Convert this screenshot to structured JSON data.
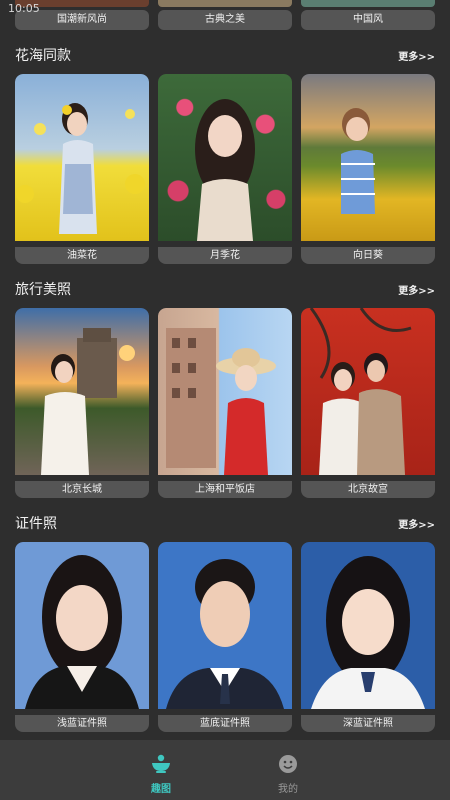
{
  "status_bar": {
    "time": "10:05"
  },
  "top_row": [
    {
      "label": "国潮新风尚",
      "color": "#6a3f2e"
    },
    {
      "label": "古典之美",
      "color": "#8a7a60"
    },
    {
      "label": "中国风",
      "color": "#5a7e72"
    }
  ],
  "sections": [
    {
      "title": "花海同款",
      "more": "更多>>",
      "items": [
        {
          "label": "油菜花",
          "theme": "rapeseed-field"
        },
        {
          "label": "月季花",
          "theme": "rose-wall"
        },
        {
          "label": "向日葵",
          "theme": "sunflower-field"
        }
      ]
    },
    {
      "title": "旅行美照",
      "more": "更多>>",
      "items": [
        {
          "label": "北京长城",
          "theme": "great-wall-sunset"
        },
        {
          "label": "上海和平饭店",
          "theme": "shanghai-street"
        },
        {
          "label": "北京故宫",
          "theme": "forbidden-city-wall"
        }
      ]
    },
    {
      "title": "证件照",
      "more": "更多>>",
      "items": [
        {
          "label": "浅蓝证件照",
          "theme": "light-blue-id"
        },
        {
          "label": "蓝底证件照",
          "theme": "blue-id"
        },
        {
          "label": "深蓝证件照",
          "theme": "dark-blue-id"
        }
      ]
    }
  ],
  "bottom_nav": [
    {
      "label": "趣图",
      "icon": "bowl-icon",
      "active": true,
      "color": "#3fc7c0"
    },
    {
      "label": "我的",
      "icon": "smiley-icon",
      "active": false,
      "color": "#9a9a9a"
    }
  ]
}
